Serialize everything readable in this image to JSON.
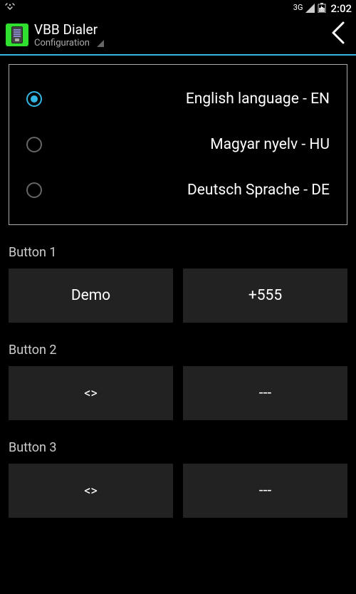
{
  "status": {
    "network_label": "3G",
    "time": "2:02"
  },
  "header": {
    "title": "VBB Dialer",
    "subtitle": "Configuration"
  },
  "languages": [
    {
      "label": "English language - EN",
      "selected": true
    },
    {
      "label": "Magyar nyelv - HU",
      "selected": false
    },
    {
      "label": "Deutsch Sprache - DE",
      "selected": false
    }
  ],
  "buttons": [
    {
      "section": "Button 1",
      "left": "Demo",
      "right": "+555"
    },
    {
      "section": "Button 2",
      "left": "<>",
      "right": "---"
    },
    {
      "section": "Button 3",
      "left": "<>",
      "right": "---"
    }
  ]
}
